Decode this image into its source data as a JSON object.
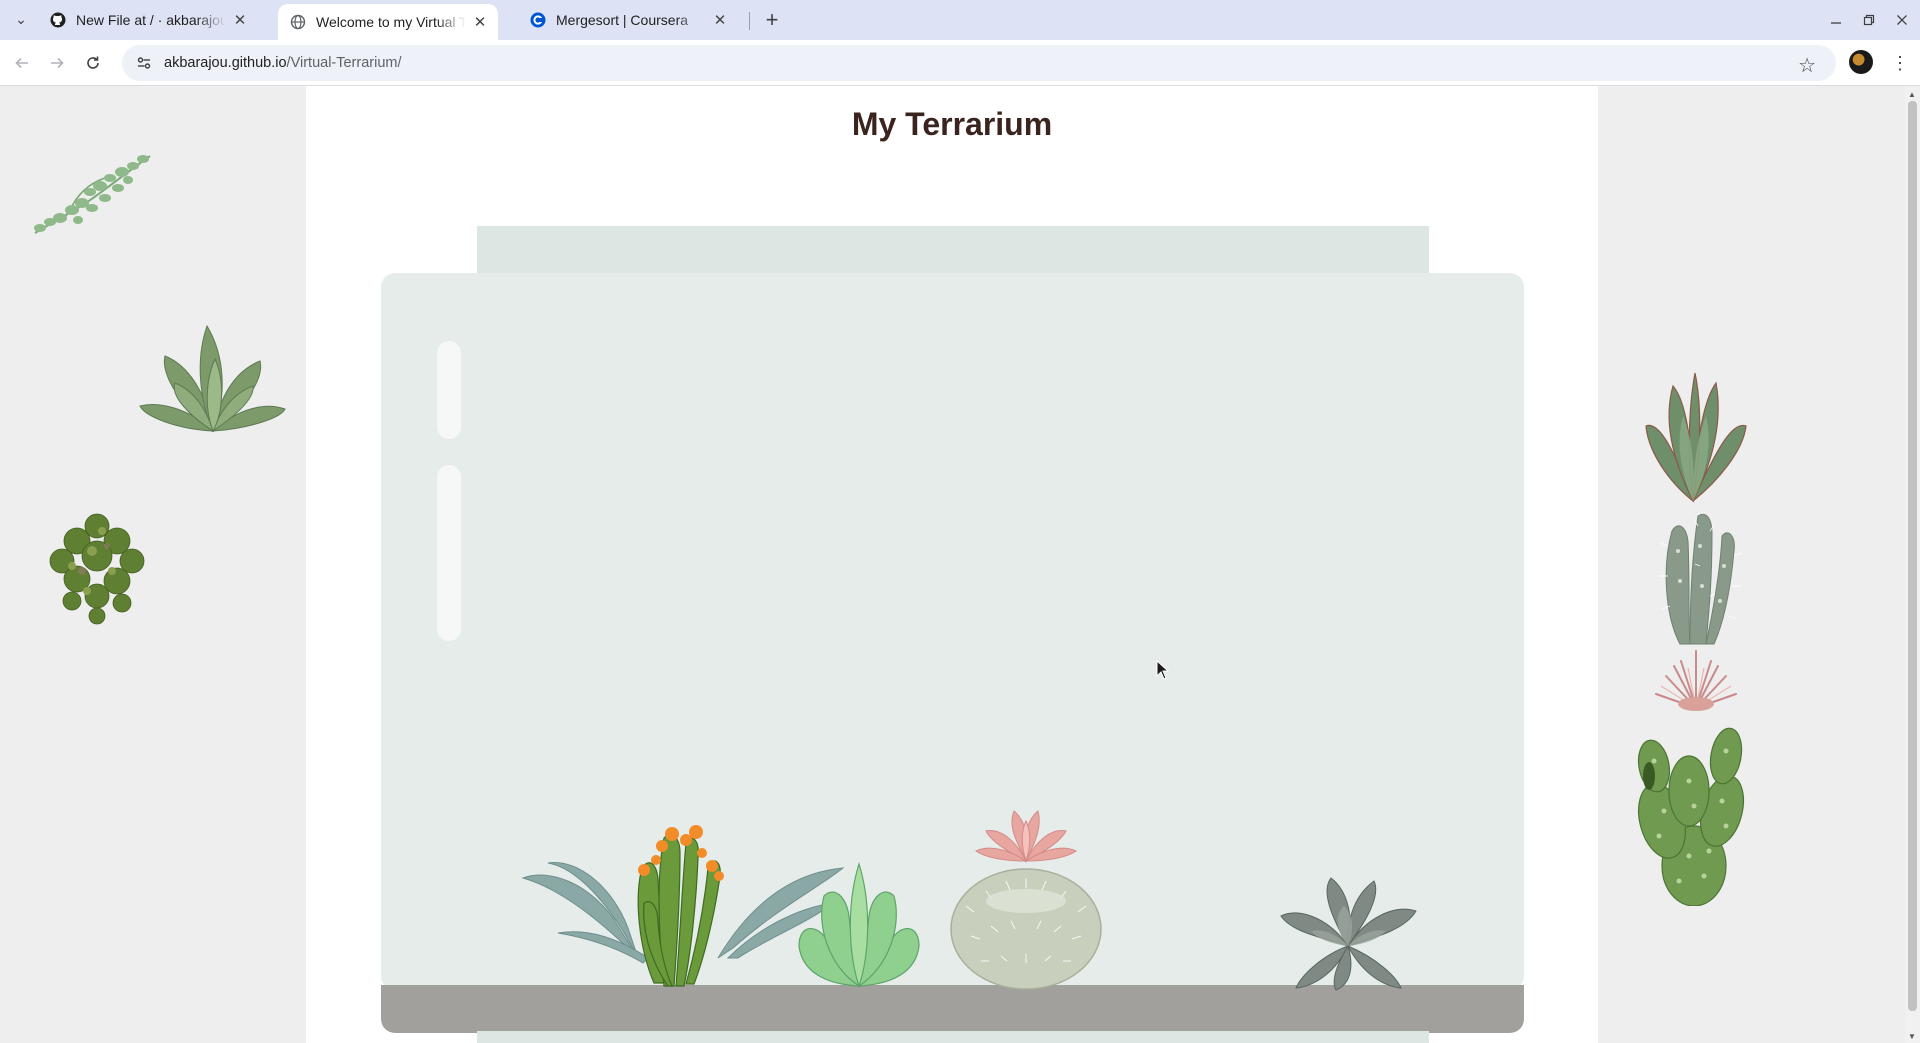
{
  "browser": {
    "tabs": [
      {
        "title": "New File at / · akbarajou/Virtual-Terrarium",
        "favicon": "github-icon",
        "active": false
      },
      {
        "title": "Welcome to my Virtual Terrarium",
        "favicon": "globe-icon",
        "active": true
      },
      {
        "title": "Mergesort | Coursera",
        "favicon": "coursera-icon",
        "active": false
      }
    ],
    "new_tab_label": "+",
    "url_domain": "akbarajou.github.io",
    "url_path": "/Virtual-Terrarium/"
  },
  "page": {
    "title": "My Terrarium"
  },
  "plants": {
    "left": [
      "plant-1",
      "plant-2",
      "plant-3"
    ],
    "right": [
      "plant-4",
      "plant-5",
      "plant-6",
      "plant-7"
    ],
    "in_jar": [
      "plant-8",
      "plant-9",
      "plant-10",
      "plant-11",
      "plant-12"
    ]
  },
  "colors": {
    "title": "#3a241d",
    "jar": "#e5ecea",
    "jar_rim": "#dce7e3",
    "dirt": "#a1a09c",
    "side_panels": "#eeeeee"
  }
}
